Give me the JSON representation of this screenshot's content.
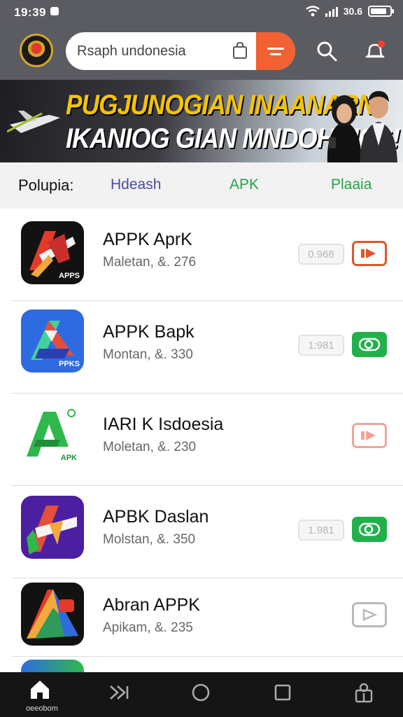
{
  "status_bar": {
    "time": "19:39",
    "battery_text": "30.6",
    "battery_level": 0.72
  },
  "header": {
    "search_text": "Rsaph undonesia",
    "icons": [
      "app-logo",
      "shopping-bag-icon",
      "filter-icon",
      "search-icon",
      "notification-bell-icon"
    ]
  },
  "banner": {
    "line1": "PUGJUNOGIAN INAANARN",
    "line2": "IKANIOG GIAN MNDOHNICS!"
  },
  "categories": {
    "label": "Polupia:",
    "tabs": [
      "Hdeash",
      "APK",
      "Plaaia"
    ]
  },
  "apps": [
    {
      "name": "APPK AprK",
      "meta": "Maletan,  &. 276",
      "size": "0.968",
      "icon_text": "APPS",
      "action": "orange-play"
    },
    {
      "name": "APPK Bapk",
      "meta": "Montan,  &. 330",
      "size": "1:981",
      "icon_text": "PPKS",
      "action": "green-toggle"
    },
    {
      "name": "IARI K Isdoesia",
      "meta": "Moletan,  &. 230",
      "size": "",
      "icon_text": "APK",
      "action": "pink-play"
    },
    {
      "name": "APBK Daslan",
      "meta": "Molstan,  &. 350",
      "size": "1.981",
      "icon_text": "",
      "action": "green-toggle"
    },
    {
      "name": "Abran APPK",
      "meta": "Apikam,  &. 235",
      "size": "",
      "icon_text": "",
      "action": "grey-play"
    }
  ],
  "bottom_nav": {
    "home_label": "oeeobom"
  },
  "colors": {
    "header_bg": "#5b5b62",
    "accent_orange": "#f26131",
    "accent_green": "#22b04b",
    "tab_purple": "#4b4aa3"
  }
}
